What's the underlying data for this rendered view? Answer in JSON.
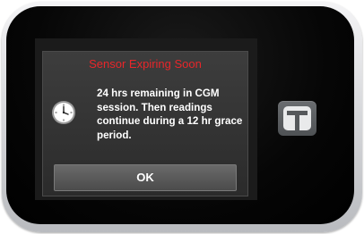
{
  "dialog": {
    "title": "Sensor Expiring Soon",
    "message": "24 hrs remaining in CGM session. Then readings continue during a 12 hr grace period.",
    "icon": "clock-icon",
    "ok_label": "OK"
  },
  "device": {
    "button_icon": "t-logo-icon"
  },
  "colors": {
    "title": "#e8262a",
    "dialog_background": "#333333",
    "device_body": "#000000",
    "button": "#5f6265"
  }
}
